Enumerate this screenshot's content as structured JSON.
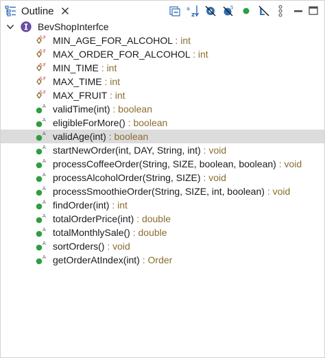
{
  "view": {
    "tab_label": "Outline",
    "tab_icon": "outline-view-icon",
    "close_icon": "close-icon"
  },
  "toolbar": {
    "buttons": [
      {
        "name": "collapse-all-icon"
      },
      {
        "name": "sort-alphabetically-icon"
      },
      {
        "name": "hide-fields-icon"
      },
      {
        "name": "hide-static-members-icon"
      },
      {
        "name": "hide-non-public-members-icon"
      },
      {
        "name": "hide-local-types-icon"
      }
    ],
    "view_menu_icon": "vertical-dots-icon",
    "minimize_icon": "minimize-icon",
    "maximize_icon": "maximize-icon"
  },
  "colors": {
    "type_color": "#8a6d2d",
    "method_green": "#2e9e3e",
    "field_brown": "#8a6b2c",
    "interface_purple": "#6a4fa6",
    "selection_bg": "#dcdcdc"
  },
  "tree": {
    "root": {
      "label": "BevShopInterfce",
      "icon": "interface-icon"
    },
    "members": [
      {
        "name": "MIN_AGE_FOR_ALCOHOL",
        "sep": " : ",
        "type": "int",
        "kind": "static-final-field",
        "selected": false
      },
      {
        "name": "MAX_ORDER_FOR_ALCOHOL",
        "sep": " : ",
        "type": "int",
        "kind": "static-final-field",
        "selected": false
      },
      {
        "name": "MIN_TIME",
        "sep": " : ",
        "type": "int",
        "kind": "static-final-field",
        "selected": false
      },
      {
        "name": "MAX_TIME",
        "sep": " : ",
        "type": "int",
        "kind": "static-final-field",
        "selected": false
      },
      {
        "name": "MAX_FRUIT",
        "sep": " : ",
        "type": "int",
        "kind": "static-final-field",
        "selected": false
      },
      {
        "name": "validTime(int)",
        "sep": " : ",
        "type": "boolean",
        "kind": "abstract-method",
        "selected": false
      },
      {
        "name": "eligibleForMore()",
        "sep": " : ",
        "type": "boolean",
        "kind": "abstract-method",
        "selected": false
      },
      {
        "name": "validAge(int)",
        "sep": " : ",
        "type": "boolean",
        "kind": "abstract-method",
        "selected": true
      },
      {
        "name": "startNewOrder(int, DAY, String, int)",
        "sep": " : ",
        "type": "void",
        "kind": "abstract-method",
        "selected": false
      },
      {
        "name": "processCoffeeOrder(String, SIZE, boolean, boolean)",
        "sep": " : ",
        "type": "void",
        "kind": "abstract-method",
        "selected": false
      },
      {
        "name": "processAlcoholOrder(String, SIZE)",
        "sep": " : ",
        "type": "void",
        "kind": "abstract-method",
        "selected": false
      },
      {
        "name": "processSmoothieOrder(String, SIZE, int, boolean)",
        "sep": " : ",
        "type": "void",
        "kind": "abstract-method",
        "selected": false
      },
      {
        "name": "findOrder(int)",
        "sep": " : ",
        "type": "int",
        "kind": "abstract-method",
        "selected": false
      },
      {
        "name": "totalOrderPrice(int)",
        "sep": " : ",
        "type": "double",
        "kind": "abstract-method",
        "selected": false
      },
      {
        "name": "totalMonthlySale()",
        "sep": " : ",
        "type": "double",
        "kind": "abstract-method",
        "selected": false
      },
      {
        "name": "sortOrders()",
        "sep": " : ",
        "type": "void",
        "kind": "abstract-method",
        "selected": false
      },
      {
        "name": "getOrderAtIndex(int)",
        "sep": " : ",
        "type": "Order",
        "kind": "abstract-method",
        "selected": false
      }
    ]
  }
}
